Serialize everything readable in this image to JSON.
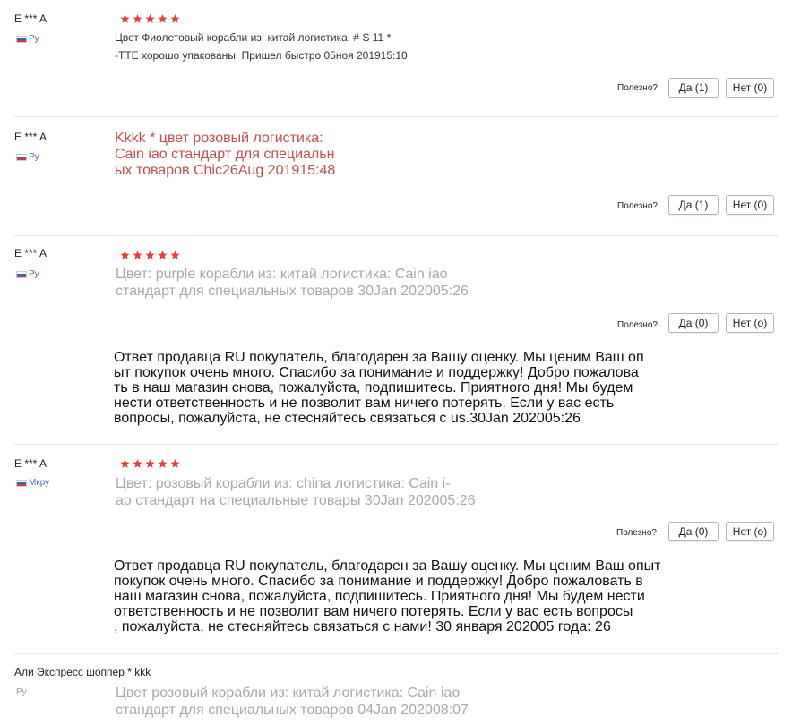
{
  "reviews": [
    {
      "author": "E *** A",
      "country": "Ру",
      "stars": 5,
      "text_lines": [
        "Цвет Фиолетовый корабли из: китай логистика: # S 11 *",
        "-TTE хорошо упакованы. Пришел быстро 05ноя 201915:10"
      ],
      "helpful_q": "Полезно?",
      "yes": "Да (1)",
      "no": "Нет (0)"
    },
    {
      "author": "E *** A",
      "country": "Ру",
      "text": "Kkkk * цвет розовый логистика:\nCain iao стандарт для специальн\nых товаров Chic26Aug 201915:48",
      "helpful_q": "Полезно?",
      "yes": "Да (1)",
      "no": "Нет (0)"
    },
    {
      "author": "E *** A",
      "country": "Ру",
      "stars": 5,
      "text": "Цвет: purple корабли из: китай логистика: Cain iao\nстандарт для специальных товаров 30Jan 202005:26",
      "helpful_q": "Полезно?",
      "yes": "Да (0)",
      "no": "Нет (о)",
      "seller_reply": "Ответ продавца RU покупатель, благодарен за Вашу оценку. Мы ценим Ваш оп\nыт покупок очень много. Спасибо за понимание и поддержку! Добро пожалова\nть в наш магазин снова, пожалуйста, подпишитесь. Приятного дня! Мы будем\nнести ответственность и не позволит вам ничего потерять. Если у вас есть\nвопросы, пожалуйста, не стесняйтесь связаться с us.30Jan 202005:26"
    },
    {
      "author": "E *** A",
      "country": "Мкру",
      "stars": 5,
      "text": "Цвет: розовый корабли из: china логистика: Cain i-\nao стандарт на специальные товары 30Jan 202005:26",
      "helpful_q": "Полезно?",
      "yes": "Да (0)",
      "no": "Нет (о)",
      "seller_reply": "Ответ продавца RU покупатель, благодарен за Вашу оценку. Мы ценим Ваш опыт\nпокупок очень много. Спасибо за понимание и поддержку! Добро пожаловать в\nнаш магазин снова, пожалуйста, подпишитесь. Приятного дня! Мы будем нести\nответственность и не позволит вам ничего потерять. Если у вас есть вопросы\n, пожалуйста, не стесняйтесь связаться с нами! 30 января 202005 года: 26"
    },
    {
      "author": "Али Экспресс шоппер * kkk",
      "country": "Ру",
      "text": "Цвет розовый корабли из: китай логистика: Cain iao\nстандарт для специальных товаров 04Jan 202008:07"
    }
  ],
  "colors": {
    "star": "#e5403a",
    "red_text": "#c0504d",
    "gray_text": "#a9a9a9",
    "link_blue": "#4a6ab8"
  }
}
